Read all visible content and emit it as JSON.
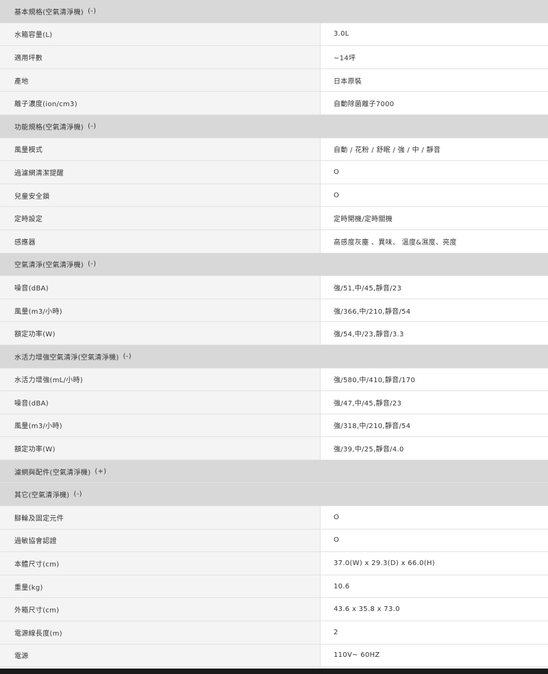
{
  "sections": [
    {
      "title": "基本規格(空氣清淨機)",
      "toggle": "(-)",
      "rows": [
        {
          "label": "水箱容量(L)",
          "value": "3.0L"
        },
        {
          "label": "適用坪數",
          "value": "~14坪"
        },
        {
          "label": "產地",
          "value": "日本原裝"
        },
        {
          "label": "離子濃度(ion/cm3)",
          "value": "自動除菌離子7000"
        }
      ]
    },
    {
      "title": "功能規格(空氣清淨機)",
      "toggle": "(-)",
      "rows": [
        {
          "label": "風量模式",
          "value": "自動 / 花粉 / 舒眠 / 強 / 中 / 靜音"
        },
        {
          "label": "過濾網清潔提醒",
          "value": "O"
        },
        {
          "label": "兒童安全鎖",
          "value": "O"
        },
        {
          "label": "定時設定",
          "value": "定時開機/定時關機"
        },
        {
          "label": "感應器",
          "value": "高感度灰塵 、異味、 溫度&濕度、亮度"
        }
      ]
    },
    {
      "title": "空氣清淨(空氣清淨機)",
      "toggle": "(-)",
      "rows": [
        {
          "label": "噪音(dBA)",
          "value": "強/51,中/45,靜音/23"
        },
        {
          "label": "風量(m3/小時)",
          "value": "強/366,中/210,靜音/54"
        },
        {
          "label": "額定功率(W)",
          "value": "強/54,中/23,靜音/3.3"
        }
      ]
    },
    {
      "title": "水活力增強空氣清淨(空氣清淨機)",
      "toggle": "(-)",
      "rows": [
        {
          "label": "水活力增強(mL/小時)",
          "value": "強/580,中/410,靜音/170"
        },
        {
          "label": "噪音(dBA)",
          "value": "強/47,中/45,靜音/23"
        },
        {
          "label": "風量(m3/小時)",
          "value": "強/318,中/210,靜音/54"
        },
        {
          "label": "額定功率(W)",
          "value": "強/39,中/25,靜音/4.0"
        }
      ]
    },
    {
      "title": "濾網與配件(空氣清淨機)",
      "toggle": "(+)",
      "rows": []
    },
    {
      "title": "其它(空氣清淨機)",
      "toggle": "(-)",
      "rows": [
        {
          "label": "腳輪及固定元件",
          "value": "O"
        },
        {
          "label": "過敏協會認證",
          "value": "O"
        },
        {
          "label": "本體尺寸(cm)",
          "value": "37.0(W) x 29.3(D) x 66.0(H)"
        },
        {
          "label": "重量(kg)",
          "value": "10.6"
        },
        {
          "label": "外箱尺寸(cm)",
          "value": "43.6 x 35.8 x 73.0"
        },
        {
          "label": "電源線長度(m)",
          "value": "2"
        },
        {
          "label": "電源",
          "value": "110V~ 60HZ"
        }
      ]
    }
  ]
}
